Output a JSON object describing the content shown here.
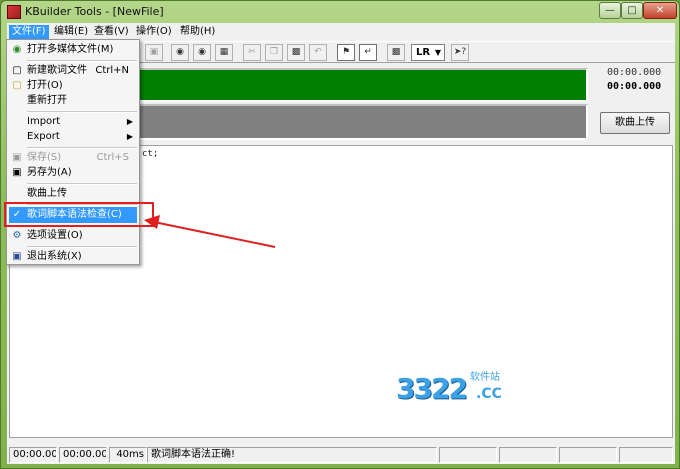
{
  "window": {
    "title": "KBuilder Tools - [NewFile]"
  },
  "menubar": {
    "items": [
      {
        "label": "文件(F)"
      },
      {
        "label": "编辑(E)"
      },
      {
        "label": "查看(V)"
      },
      {
        "label": "操作(O)"
      },
      {
        "label": "帮助(H)"
      }
    ]
  },
  "toolbar": {
    "lr_label": "LR"
  },
  "display": {
    "time_top": "00:00.000",
    "time_bottom": "00:00.000",
    "upload_button": "歌曲上传"
  },
  "editor": {
    "visible_text": "ct;"
  },
  "file_menu": {
    "items": [
      {
        "label": "打开多媒体文件(M)",
        "shortcut": ""
      },
      {
        "label": "新建歌词文件",
        "shortcut": "Ctrl+N"
      },
      {
        "label": "打开(O)",
        "shortcut": ""
      },
      {
        "label": "重新打开",
        "shortcut": ""
      },
      {
        "label": "Import",
        "shortcut": ""
      },
      {
        "label": "Export",
        "shortcut": ""
      },
      {
        "label": "保存(S)",
        "shortcut": "Ctrl+S"
      },
      {
        "label": "另存为(A)",
        "shortcut": ""
      },
      {
        "label": "歌曲上传",
        "shortcut": ""
      },
      {
        "label": "歌词脚本语法检查(C)",
        "shortcut": ""
      },
      {
        "label": "选项设置(O)",
        "shortcut": ""
      },
      {
        "label": "退出系统(X)",
        "shortcut": ""
      }
    ]
  },
  "statusbar": {
    "time1": "00:00.00",
    "time2": "00:00.000",
    "ms": "40ms",
    "message": "歌词脚本语法正确!"
  },
  "watermark": {
    "number": "3322",
    "suffix": ".CC",
    "site": "软件站"
  },
  "colors": {
    "highlight": "#3399ff",
    "green_panel": "#008000",
    "gray_panel": "#808080",
    "annotation": "#e02020"
  }
}
